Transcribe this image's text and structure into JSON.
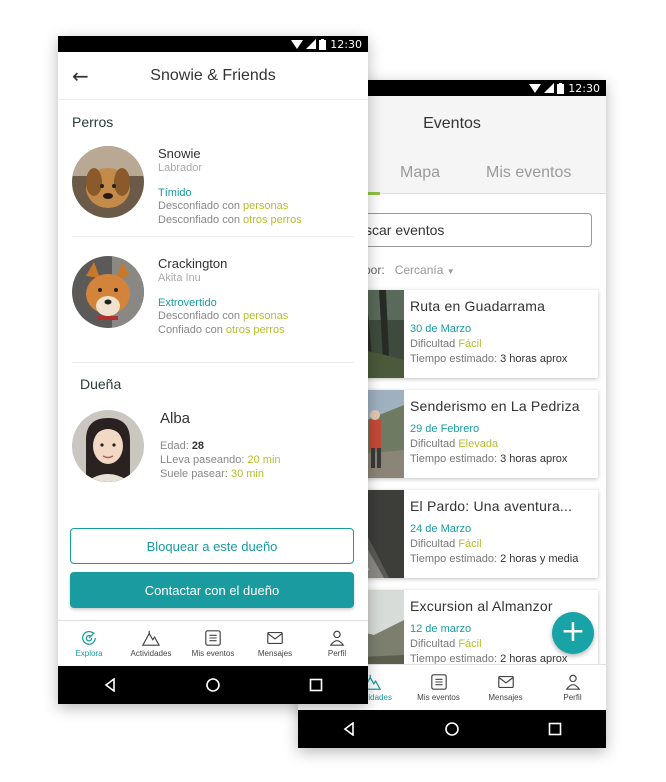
{
  "status": {
    "time": "12:30"
  },
  "events_screen": {
    "title": "Eventos",
    "tabs": [
      "Mapa",
      "Mis eventos"
    ],
    "search_placeholder": "scar eventos",
    "sort_label": "por:",
    "sort_value": "Cercanía",
    "events": [
      {
        "title": "Ruta en Guadarrama",
        "date": "30 de Marzo",
        "difficulty_label": "Dificultad",
        "difficulty": "Fácil",
        "time_label": "Tiempo estimado:",
        "time": "3 horas aprox"
      },
      {
        "title": "Senderismo en La Pedriza",
        "date": "29 de Febrero",
        "difficulty_label": "Dificultad",
        "difficulty": "Elevada",
        "time_label": "Tiempo estimado:",
        "time": "3 horas aprox"
      },
      {
        "title": "El Pardo: Una aventura...",
        "date": "24 de Marzo",
        "difficulty_label": "Dificultad",
        "difficulty": "Fácil",
        "time_label": "Tiempo estimado:",
        "time": "2 horas y media"
      },
      {
        "title": "Excursion al Almanzor",
        "date": "12 de marzo",
        "difficulty_label": "Dificultad",
        "difficulty": "Fácil",
        "time_label": "Tiempo estimado:",
        "time": "2 horas aprox"
      }
    ],
    "fab_label": "+",
    "bottom_tabs": [
      {
        "label": "Actividades",
        "icon": "mountain-icon",
        "active": true
      },
      {
        "label": "Mis eventos",
        "icon": "list-icon"
      },
      {
        "label": "Mensajes",
        "icon": "mail-icon"
      },
      {
        "label": "Perfil",
        "icon": "person-icon"
      }
    ]
  },
  "profile_screen": {
    "title": "Snowie & Friends",
    "pets_section": "Perros",
    "pets": [
      {
        "name": "Snowie",
        "breed": "Labrador",
        "trait": "Tímido",
        "line1_prefix": "Desconfiado con",
        "line1_value": "personas",
        "line2_prefix": "Desconfiado con",
        "line2_value": "otros perros"
      },
      {
        "name": "Crackington",
        "breed": "Akita Inu",
        "trait": "Extrovertido",
        "line1_prefix": "Desconfiado con",
        "line1_value": "personas",
        "line2_prefix": "Confiado con",
        "line2_value": "otros perros"
      }
    ],
    "owner_section": "Dueña",
    "owner": {
      "name": "Alba",
      "age_label": "Edad:",
      "age": "28",
      "walking_label": "LLeva paseando:",
      "walking": "20 min",
      "usual_label": "Suele pasear:",
      "usual": "30 min"
    },
    "block_button": "Bloquear a este dueño",
    "contact_button": "Contactar con el dueño",
    "bottom_tabs": [
      {
        "label": "Explora",
        "icon": "explore-icon",
        "active": true
      },
      {
        "label": "Actividades",
        "icon": "mountain-icon"
      },
      {
        "label": "Mis eventos",
        "icon": "list-icon"
      },
      {
        "label": "Mensajes",
        "icon": "mail-icon"
      },
      {
        "label": "Perfil",
        "icon": "person-icon"
      }
    ]
  },
  "colors": {
    "accent": "#1a9ba0",
    "highlight": "#b5bf2a",
    "tab_underline": "#8cc63f"
  }
}
